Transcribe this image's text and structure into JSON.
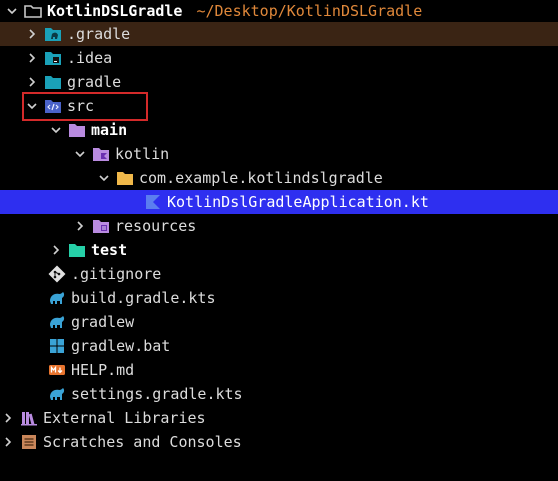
{
  "project": {
    "name": "KotlinDSLGradle",
    "path": "~/Desktop/KotlinDSLGradle"
  },
  "tree": {
    "gradle_dir": ".gradle",
    "idea_dir": ".idea",
    "gradle_folder": "gradle",
    "src": "src",
    "main": "main",
    "kotlin": "kotlin",
    "package": "com.example.kotlindslgradle",
    "app_file": "KotlinDslGradleApplication.kt",
    "resources": "resources",
    "test": "test",
    "gitignore": ".gitignore",
    "build_gradle": "build.gradle.kts",
    "gradlew": "gradlew",
    "gradlew_bat": "gradlew.bat",
    "help": "HELP.md",
    "settings_gradle": "settings.gradle.kts",
    "external_libraries": "External Libraries",
    "scratches": "Scratches and Consoles"
  }
}
